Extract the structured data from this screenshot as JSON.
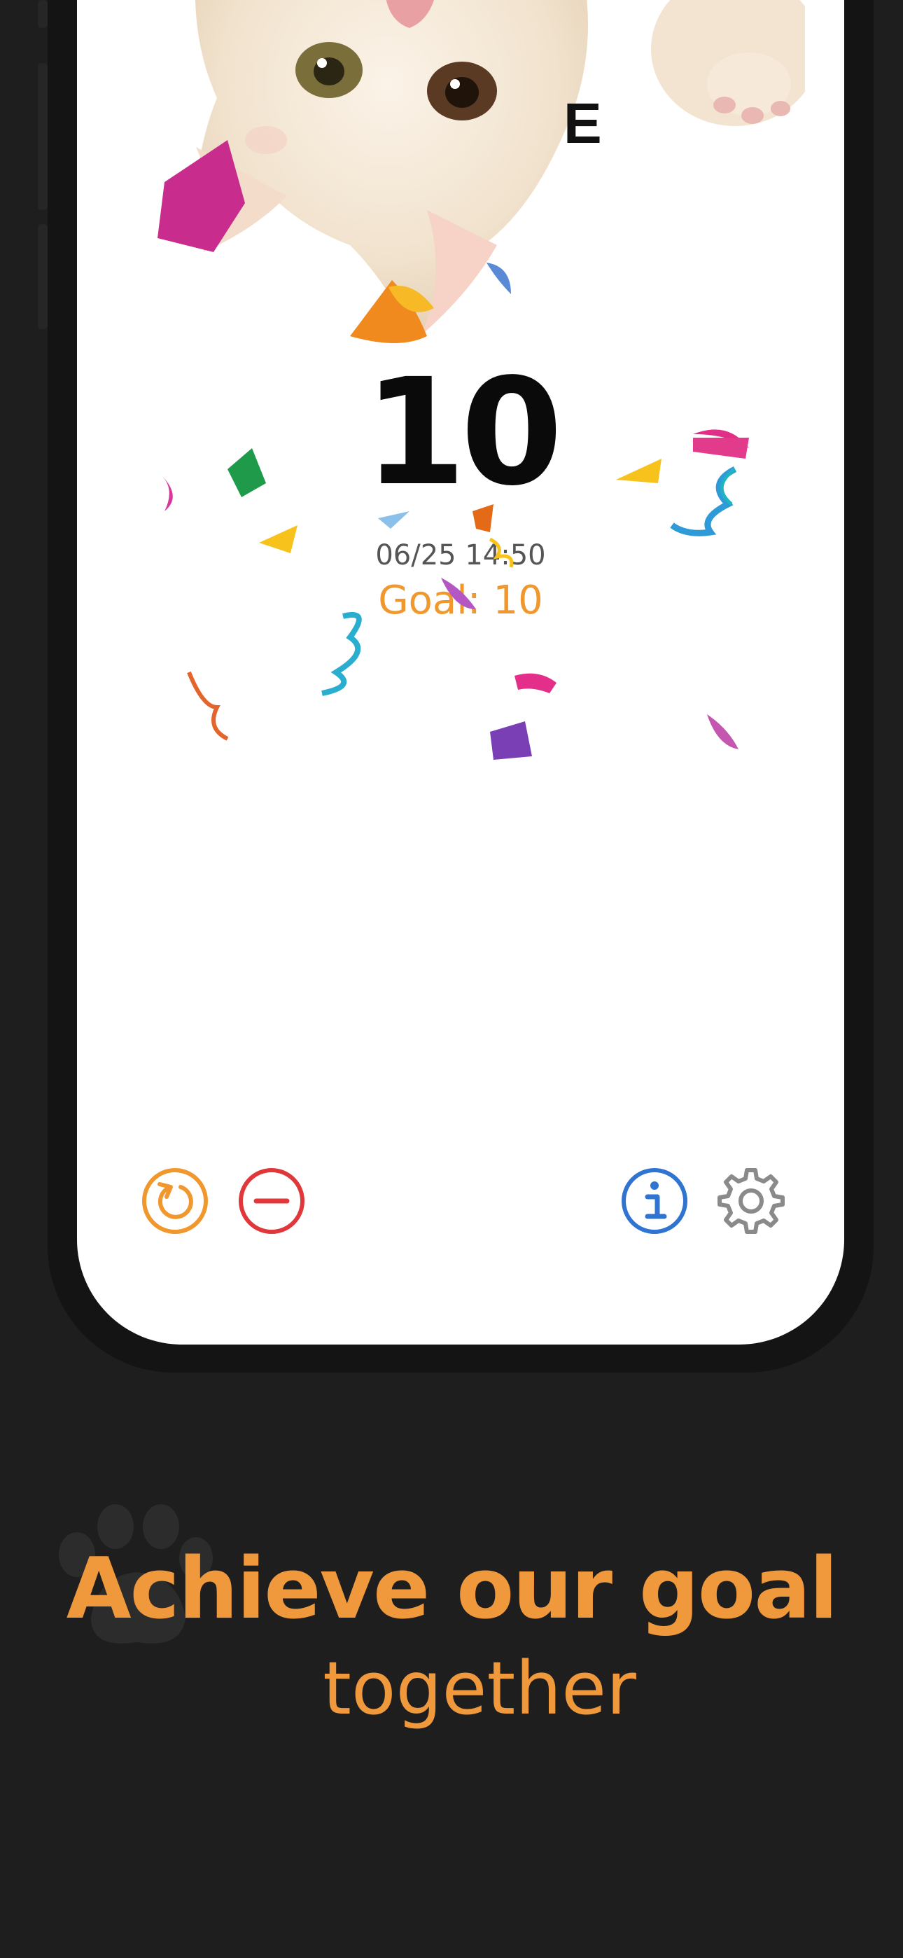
{
  "app": {
    "title_fragment": "E",
    "count": "10",
    "timestamp": "06/25 14:50",
    "goal_label": "Goal:",
    "goal_value": "10"
  },
  "toolbar": {
    "reset_icon": "reset-icon",
    "minus_icon": "minus-icon",
    "info_icon": "info-icon",
    "settings_icon": "gear-icon"
  },
  "promo": {
    "headline": "Achieve our goal",
    "subline": "together"
  },
  "colors": {
    "accent": "#f0982e",
    "minus": "#e0373a",
    "info": "#2f74d0",
    "settings": "#8a8a8a",
    "background": "#1e1e1e"
  }
}
